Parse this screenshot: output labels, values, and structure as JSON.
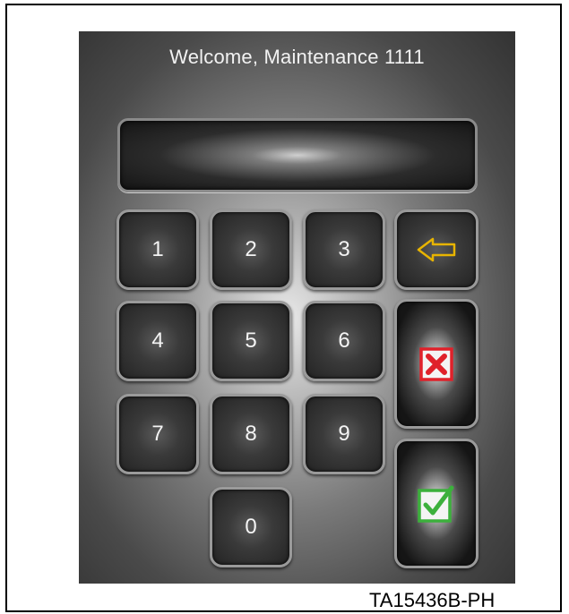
{
  "welcome_text": "Welcome, Maintenance 1111",
  "display": {
    "value": ""
  },
  "keys": [
    "1",
    "2",
    "3",
    "4",
    "5",
    "6",
    "7",
    "8",
    "9",
    "0"
  ],
  "icons": {
    "backspace": "left-arrow-icon",
    "cancel": "red-x-icon",
    "confirm": "green-check-icon"
  },
  "colors": {
    "backspace_arrow": "#e8b400",
    "cancel": "#e0212a",
    "confirm": "#3cb03c"
  },
  "caption": "TA15436B-PH"
}
